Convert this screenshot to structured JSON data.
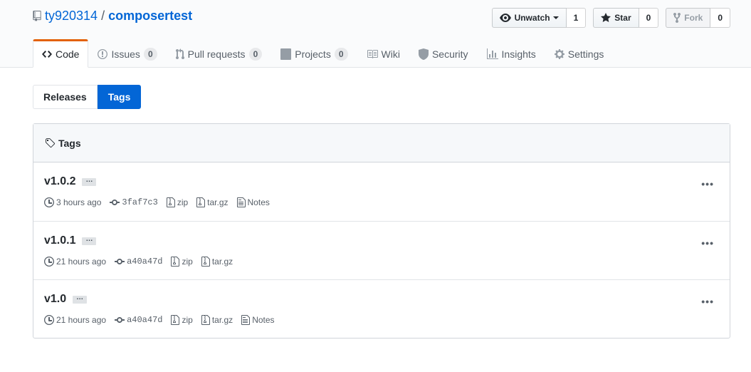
{
  "repo": {
    "owner": "ty920314",
    "separator": "/",
    "name": "composertest"
  },
  "actions": {
    "watch": {
      "label": "Unwatch",
      "count": "1"
    },
    "star": {
      "label": "Star",
      "count": "0"
    },
    "fork": {
      "label": "Fork",
      "count": "0"
    }
  },
  "tabs": [
    {
      "label": "Code",
      "counter": ""
    },
    {
      "label": "Issues",
      "counter": "0"
    },
    {
      "label": "Pull requests",
      "counter": "0"
    },
    {
      "label": "Projects",
      "counter": "0"
    },
    {
      "label": "Wiki",
      "counter": ""
    },
    {
      "label": "Security",
      "counter": ""
    },
    {
      "label": "Insights",
      "counter": ""
    },
    {
      "label": "Settings",
      "counter": ""
    }
  ],
  "subnav": {
    "releases": "Releases",
    "tags": "Tags"
  },
  "box": {
    "title": "Tags"
  },
  "tags": [
    {
      "name": "v1.0.2",
      "toggle": "…",
      "time": "3 hours ago",
      "sha": "3faf7c3",
      "zip": "zip",
      "tar": "tar.gz",
      "notes": "Notes",
      "more": "•••"
    },
    {
      "name": "v1.0.1",
      "toggle": "…",
      "time": "21 hours ago",
      "sha": "a40a47d",
      "zip": "zip",
      "tar": "tar.gz",
      "notes": "",
      "more": "•••"
    },
    {
      "name": "v1.0",
      "toggle": "…",
      "time": "21 hours ago",
      "sha": "a40a47d",
      "zip": "zip",
      "tar": "tar.gz",
      "notes": "Notes",
      "more": "•••"
    }
  ],
  "colors": {
    "link": "#0366d6",
    "accent_tab": "#e36209",
    "selected_subnav": "#0366d6"
  }
}
